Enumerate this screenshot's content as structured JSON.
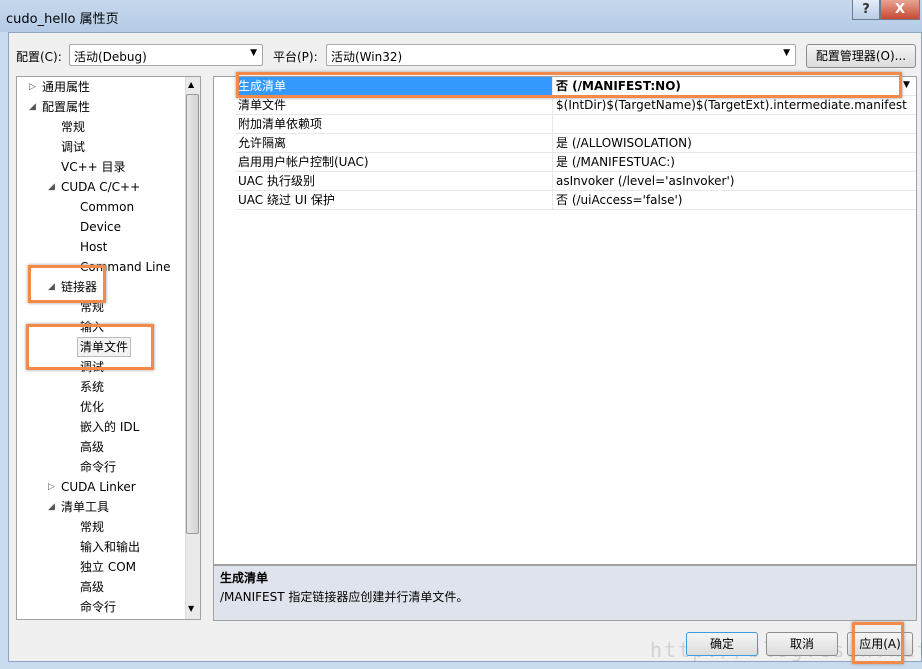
{
  "window": {
    "title": "cudo_hello 属性页",
    "help": "?",
    "close": "X"
  },
  "toolbar": {
    "config_label": "配置(C):",
    "config_value": "活动(Debug)",
    "platform_label": "平台(P):",
    "platform_value": "活动(Win32)",
    "config_manager": "配置管理器(O)..."
  },
  "tree": [
    {
      "label": "通用属性",
      "level": 0,
      "arrow": "▷"
    },
    {
      "label": "配置属性",
      "level": 0,
      "arrow": "◢"
    },
    {
      "label": "常规",
      "level": 1
    },
    {
      "label": "调试",
      "level": 1
    },
    {
      "label": "VC++ 目录",
      "level": 1
    },
    {
      "label": "CUDA C/C++",
      "level": 1,
      "arrow": "◢"
    },
    {
      "label": "Common",
      "level": 2
    },
    {
      "label": "Device",
      "level": 2
    },
    {
      "label": "Host",
      "level": 2
    },
    {
      "label": "Command Line",
      "level": 2
    },
    {
      "label": "链接器",
      "level": 1,
      "arrow": "◢"
    },
    {
      "label": "常规",
      "level": 2
    },
    {
      "label": "输入",
      "level": 2
    },
    {
      "label": "清单文件",
      "level": 2,
      "selected": true
    },
    {
      "label": "调试",
      "level": 2
    },
    {
      "label": "系统",
      "level": 2
    },
    {
      "label": "优化",
      "level": 2
    },
    {
      "label": "嵌入的 IDL",
      "level": 2
    },
    {
      "label": "高级",
      "level": 2
    },
    {
      "label": "命令行",
      "level": 2
    },
    {
      "label": "CUDA Linker",
      "level": 1,
      "arrow": "▷"
    },
    {
      "label": "清单工具",
      "level": 1,
      "arrow": "◢"
    },
    {
      "label": "常规",
      "level": 2
    },
    {
      "label": "输入和输出",
      "level": 2
    },
    {
      "label": "独立 COM",
      "level": 2
    },
    {
      "label": "高级",
      "level": 2
    },
    {
      "label": "命令行",
      "level": 2
    }
  ],
  "properties": [
    {
      "name": "生成清单",
      "value": "否 (/MANIFEST:NO)",
      "selected": true
    },
    {
      "name": "清单文件",
      "value": "$(IntDir)$(TargetName)$(TargetExt).intermediate.manifest"
    },
    {
      "name": "附加清单依赖项",
      "value": ""
    },
    {
      "name": "允许隔离",
      "value": "是 (/ALLOWISOLATION)"
    },
    {
      "name": "启用用户帐户控制(UAC)",
      "value": "是 (/MANIFESTUAC:)"
    },
    {
      "name": "UAC 执行级别",
      "value": "asInvoker (/level='asInvoker')"
    },
    {
      "name": "UAC 绕过 UI 保护",
      "value": "否 (/uiAccess='false')"
    }
  ],
  "description": {
    "title": "生成清单",
    "text": "/MANIFEST 指定链接器应创建并行清单文件。"
  },
  "buttons": {
    "ok": "确定",
    "cancel": "取消",
    "apply": "应用(A)"
  },
  "watermark": "http://blog.csdn.net/",
  "colors": {
    "selection": "#3399ff",
    "highlight_box": "#f48a4a"
  }
}
